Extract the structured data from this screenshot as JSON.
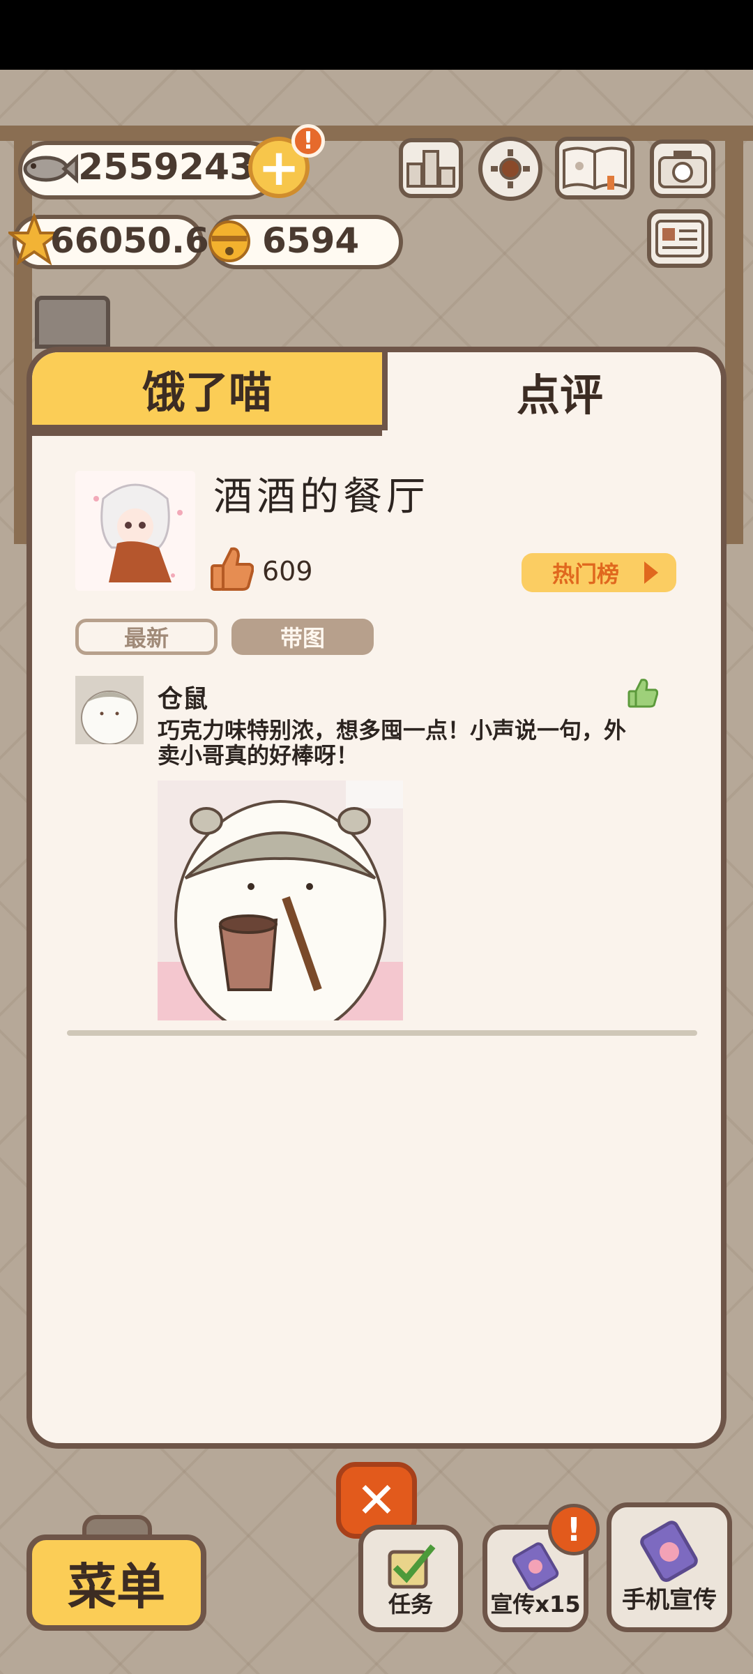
{
  "hud": {
    "fish_count": "25592432",
    "star_count": "66050.6",
    "bell_count": "6594",
    "plus_alert": "!"
  },
  "tabs": [
    {
      "label": "饿了喵",
      "active": true
    },
    {
      "label": "点评",
      "active": false
    }
  ],
  "restaurant": {
    "name": "酒酒的餐厅",
    "likes": "609",
    "hot_list_label": "热门榜"
  },
  "filters": {
    "newest": "最新",
    "with_pictures": "带图"
  },
  "reviews": [
    {
      "reviewer": "仓鼠",
      "text": "巧克力味特别浓，想多囤一点！小声说一句，外卖小哥真的好棒呀！"
    }
  ],
  "bottom": {
    "menu_label": "菜单",
    "tasks_label": "任务",
    "promo_label": "宣传x15",
    "phone_promo_label": "手机宣传",
    "promo_alert": "!"
  },
  "colors": {
    "accent_yellow": "#fbcd56",
    "panel_bg": "#faf3ec",
    "frame_brown": "#6e5548",
    "close_red": "#e25a1c",
    "like_orange": "#e0681e"
  }
}
